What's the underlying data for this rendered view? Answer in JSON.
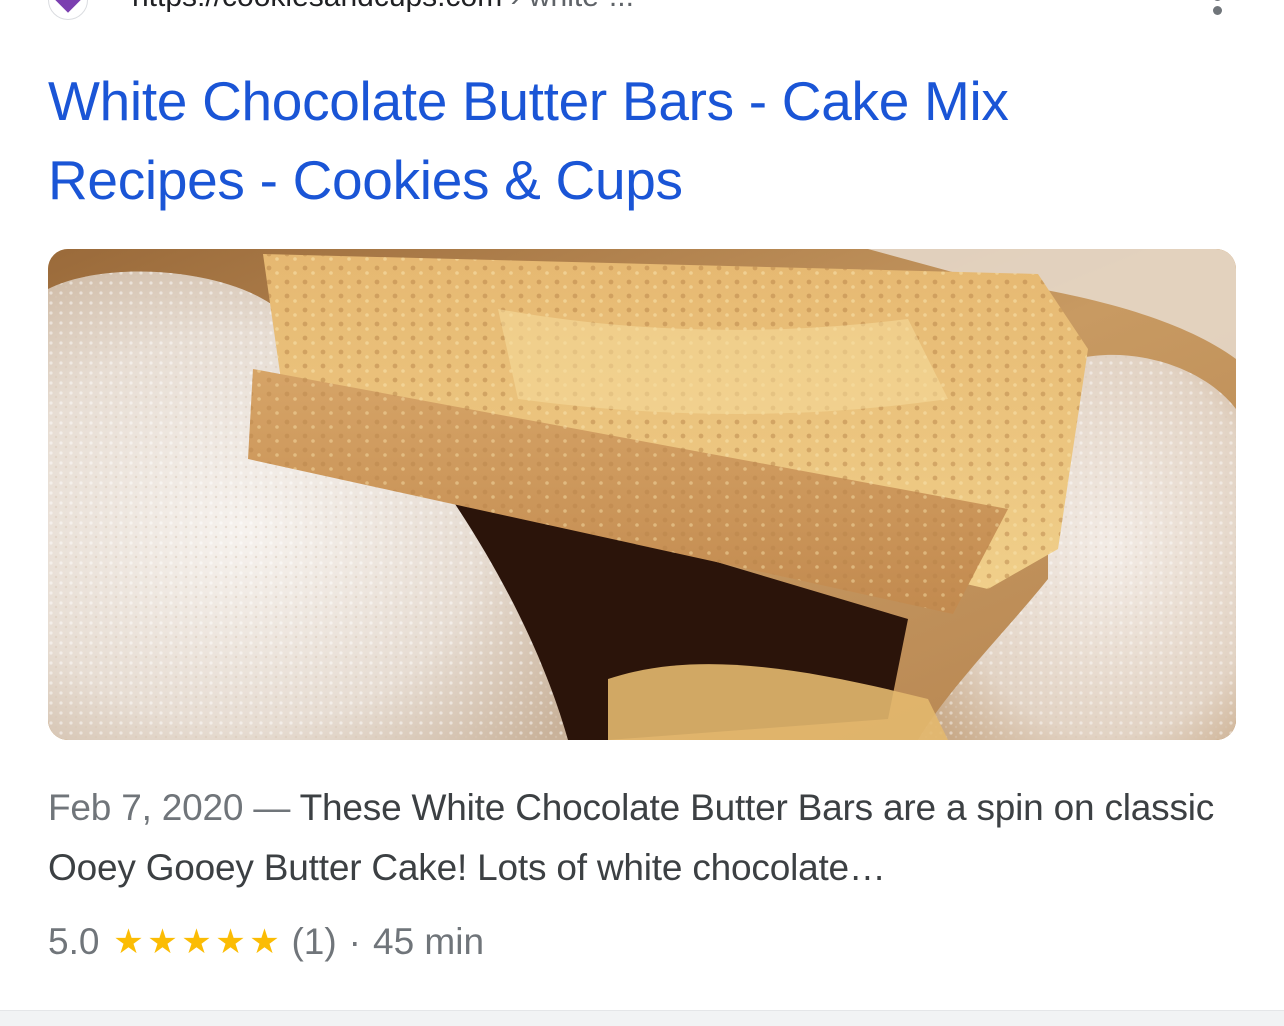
{
  "result": {
    "url_text": "https://cookiesandcups.com",
    "breadcrumb_text": "› white-...",
    "title": "White Chocolate Butter Bars - Cake Mix Recipes - Cookies & Cups",
    "date": "Feb 7, 2020",
    "dash": "—",
    "snippet": "These White Chocolate Butter Bars are a spin on classic Ooey Gooey Butter Cake! Lots of white chocolate…",
    "rating_value": "5.0",
    "rating_stars": 5,
    "review_count": "(1)",
    "separator": "·",
    "duration": "45 min"
  },
  "icons": {
    "favicon": "site-favicon-icon",
    "more": "more-vertical-icon",
    "star": "star-icon"
  },
  "colors": {
    "link_blue": "#1a55d6",
    "star_yellow": "#fbbc04",
    "text_gray": "#70757a",
    "text_dark": "#3c4043"
  }
}
